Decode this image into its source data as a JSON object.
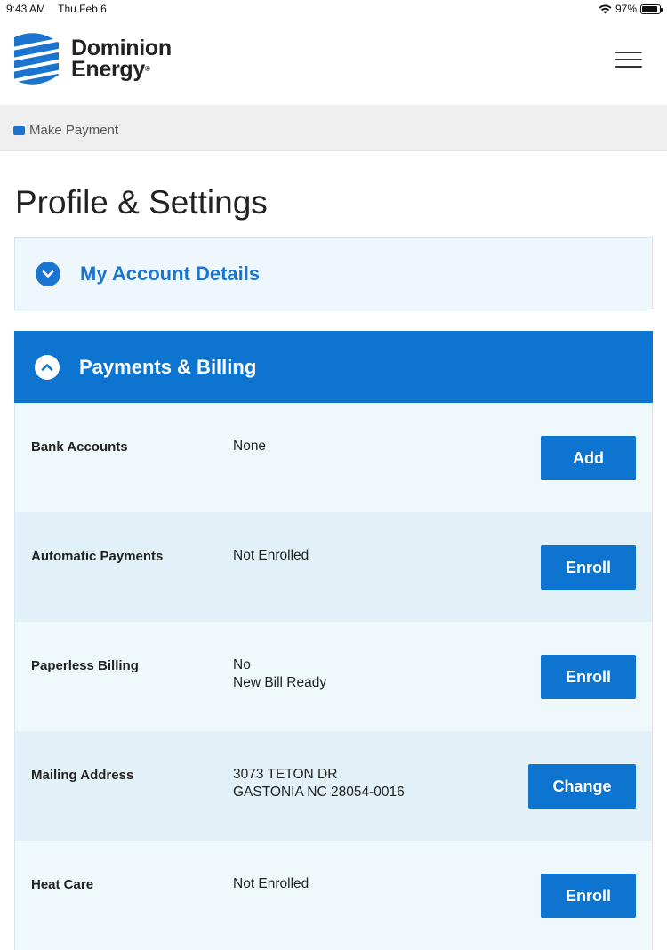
{
  "status_bar": {
    "time": "9:43 AM",
    "date": "Thu Feb 6",
    "battery": "97%"
  },
  "header": {
    "brand_line1": "Dominion",
    "brand_line2": "Energy",
    "brand_mark": "®"
  },
  "breadcrumb": {
    "label": "Make Payment"
  },
  "page": {
    "title": "Profile & Settings"
  },
  "sections": {
    "account_details": {
      "title": "My Account Details"
    },
    "payments_billing": {
      "title": "Payments & Billing"
    }
  },
  "rows": [
    {
      "label": "Bank Accounts",
      "value1": "None",
      "value2": "",
      "button": "Add"
    },
    {
      "label": "Automatic Payments",
      "value1": "Not Enrolled",
      "value2": "",
      "button": "Enroll"
    },
    {
      "label": "Paperless Billing",
      "value1": "No",
      "value2": "New Bill Ready",
      "button": "Enroll"
    },
    {
      "label": "Mailing Address",
      "value1": "3073 TETON DR",
      "value2": "GASTONIA NC 28054-0016",
      "button": "Change"
    },
    {
      "label": "Heat Care",
      "value1": "Not Enrolled",
      "value2": "",
      "button": "Enroll"
    }
  ],
  "colors": {
    "brand_blue": "#0d74cf",
    "row_light": "#eff8fb",
    "row_dark": "#e2f1f8"
  },
  "icons": [
    "wifi-icon",
    "battery-icon",
    "hamburger-menu-icon",
    "wallet-icon",
    "chevron-down-icon",
    "chevron-up-icon"
  ]
}
